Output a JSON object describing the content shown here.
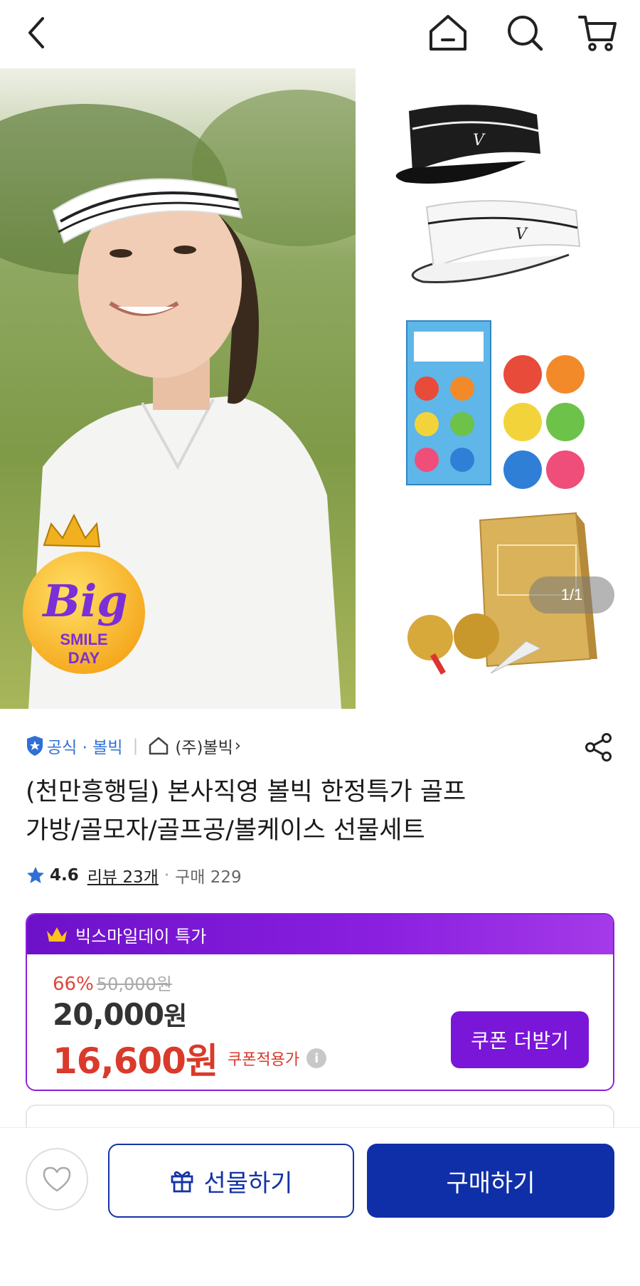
{
  "header": {
    "back_icon": "chevron-left-icon",
    "home_icon": "home-icon",
    "search_icon": "search-icon",
    "cart_icon": "cart-icon"
  },
  "gallery": {
    "badge": {
      "line1": "Big",
      "line2": "SMILE",
      "line3": "DAY"
    },
    "counter": "1/1"
  },
  "seller": {
    "official_label": "공식 · 볼빅",
    "store_name": "(주)볼빅",
    "store_arrow": "›"
  },
  "product": {
    "title_line1": "(천만흥행딜) 본사직영 볼빅 한정특가 골프",
    "title_line2": "가방/골모자/골프공/볼케이스 선물세트"
  },
  "rating": {
    "score": "4.6",
    "reviews": "리뷰 23개",
    "separator": "·",
    "purchases": "구매 229"
  },
  "deal": {
    "header_label": "빅스마일데이 특가",
    "discount_pct": "66%",
    "original_price": "50,000원",
    "price_number": "20,000",
    "price_unit": "원",
    "coupon_price": "16,600원",
    "coupon_price_label": "쿠폰적용가",
    "info_symbol": "i",
    "coupon_button": "쿠폰 더받기",
    "accent_color": "#7a16d8",
    "sale_color": "#d93a2b"
  },
  "bottom": {
    "gift_button": "선물하기",
    "buy_button": "구매하기",
    "primary_color": "#0f2fa8"
  }
}
